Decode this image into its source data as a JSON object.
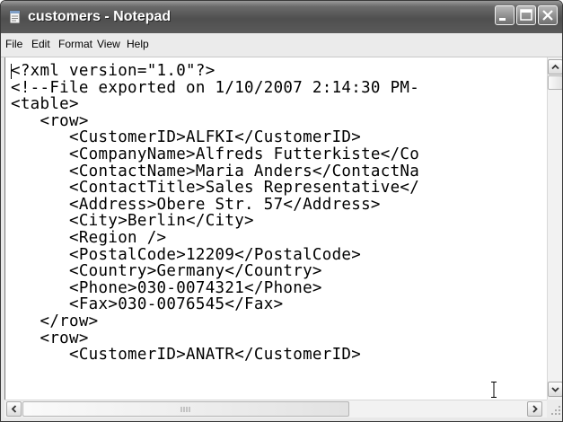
{
  "window": {
    "title": "customers - Notepad"
  },
  "menu": [
    "File",
    "Edit",
    "Format",
    "View",
    "Help"
  ],
  "editor": {
    "lines": [
      "<?xml version=\"1.0\"?>",
      "<!--File exported on 1/10/2007 2:14:30 PM-",
      "<table>",
      "   <row>",
      "      <CustomerID>ALFKI</CustomerID>",
      "      <CompanyName>Alfreds Futterkiste</Co",
      "      <ContactName>Maria Anders</ContactNa",
      "      <ContactTitle>Sales Representative</",
      "      <Address>Obere Str. 57</Address>",
      "      <City>Berlin</City>",
      "      <Region />",
      "      <PostalCode>12209</PostalCode>",
      "      <Country>Germany</Country>",
      "      <Phone>030-0074321</Phone>",
      "      <Fax>030-0076545</Fax>",
      "   </row>",
      "   <row>",
      "      <CustomerID>ANATR</CustomerID>"
    ]
  },
  "icons": {
    "app": "notepad-icon",
    "minimize": "minimize-icon",
    "maximize": "maximize-icon",
    "close": "close-icon",
    "cursor": "text-cursor-icon"
  }
}
